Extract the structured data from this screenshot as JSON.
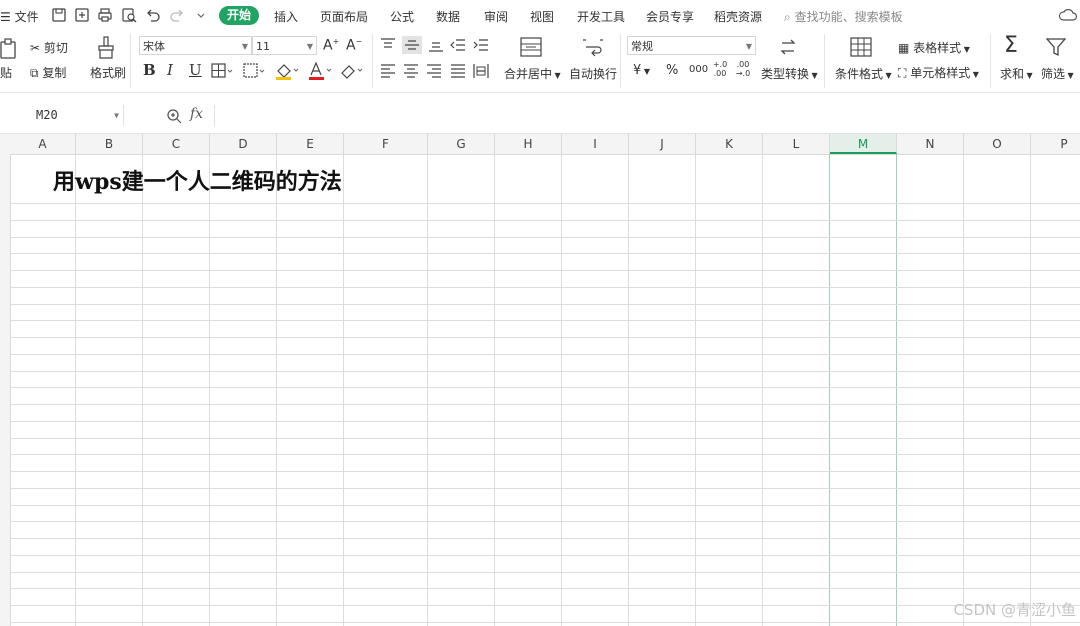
{
  "menubar": {
    "file": "文件",
    "tabs": [
      "开始",
      "插入",
      "页面布局",
      "公式",
      "数据",
      "审阅",
      "视图",
      "开发工具",
      "会员专享",
      "稻壳资源"
    ],
    "search_placeholder": "查找功能、搜索模板"
  },
  "ribbon": {
    "paste": "贴",
    "cut": "剪切",
    "copy": "复制",
    "format_painter": "格式刷",
    "font_name": "宋体",
    "font_size": "11",
    "merge_center": "合并居中",
    "wrap_text": "自动换行",
    "number_format": "常规",
    "type_convert": "类型转换",
    "conditional_format": "条件格式",
    "table_style": "表格样式",
    "cell_style": "单元格样式",
    "sum": "求和",
    "filter": "筛选",
    "fmt_bold": "B",
    "fmt_italic": "I",
    "fmt_underline": "U",
    "currency": "¥",
    "percent": "%",
    "thousands": "000",
    "dec_increase": "+.0 .00",
    "dec_decrease": ".00 →.0"
  },
  "formula_bar": {
    "cell_ref": "M20",
    "fx": "fx",
    "value": ""
  },
  "grid": {
    "columns": [
      "A",
      "B",
      "C",
      "D",
      "E",
      "F",
      "G",
      "H",
      "I",
      "J",
      "K",
      "L",
      "M",
      "N",
      "O",
      "P"
    ],
    "selected_column": "M",
    "title_cell_text": "用wps建一个人二维码的方法"
  },
  "watermark": "CSDN @青涩小鱼",
  "colors": {
    "accent": "#1fa463",
    "selected_header": "#1a9a5c"
  }
}
